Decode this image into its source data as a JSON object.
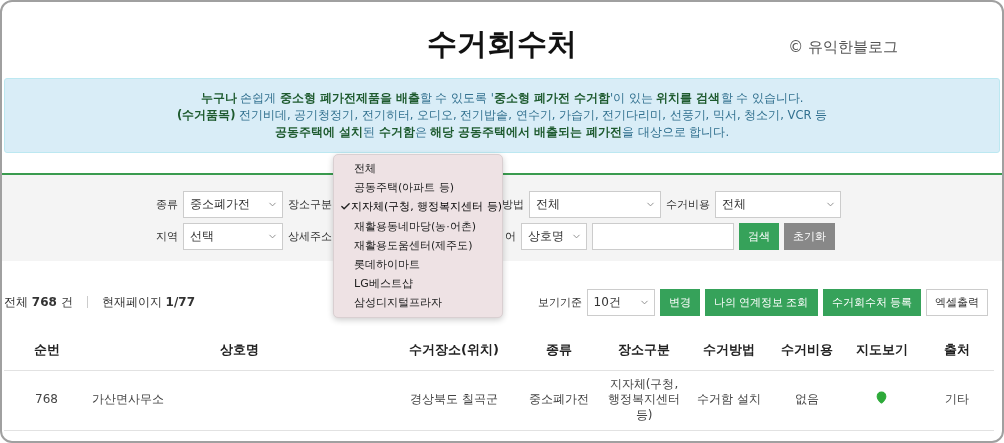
{
  "header": {
    "title": "수거회수처",
    "credit": "© 유익한블로그"
  },
  "notice": {
    "lines": [
      "**누구나** 손쉽게 **중소형 폐가전제품을 배출**할 수 있도록 '**중소형 폐가전 수거함**'이 있는 **위치를 검색**할 수 있습니다.",
      "**(수거품목)** 전기비데, 공기청정기, 전기히터, 오디오, 전기밥솥, 연수기, 가습기, 전기다리미, 선풍기, 믹서, 청소기, VCR 등",
      "**공동주택에 설치**된 **수거함**은 **해당 공동주택에서 배출되는 폐가전**을 대상으로 합니다."
    ]
  },
  "filters": [
    [
      {
        "kind": "select",
        "label": "종류",
        "value": "중소폐가전"
      },
      {
        "kind": "covered",
        "label": "장소구분"
      },
      {
        "kind": "select",
        "label": "방법",
        "value": "전체"
      },
      {
        "kind": "select",
        "label": "수거비용",
        "value": "전체"
      }
    ],
    [
      {
        "kind": "select",
        "label": "지역",
        "value": "선택"
      },
      {
        "kind": "covered",
        "label": "상세주소"
      },
      {
        "kind": "select",
        "label": "어",
        "value": "상호명"
      },
      {
        "kind": "input"
      },
      {
        "kind": "button",
        "label": "검색"
      },
      {
        "kind": "button",
        "label": "초기화"
      }
    ]
  ],
  "dropdown": {
    "items": [
      {
        "label": "전체",
        "selected": false
      },
      {
        "label": "공동주택(아파트 등)",
        "selected": false
      },
      {
        "label": "지자체(구청, 행정복지센터 등)",
        "selected": true
      },
      {
        "label": "재활용동네마당(농·어촌)",
        "selected": false
      },
      {
        "label": "재활용도움센터(제주도)",
        "selected": false
      },
      {
        "label": "롯데하이마트",
        "selected": false
      },
      {
        "label": "LG베스트샵",
        "selected": false
      },
      {
        "label": "삼성디지털프라자",
        "selected": false
      }
    ]
  },
  "summary": {
    "total": "전체 **768** 건",
    "page": "현재페이지 **1/77**",
    "view_label": "보기기준",
    "view_value": "10건",
    "buttons": [
      "변경",
      "나의 연계정보 조회",
      "수거회수처 등록",
      "엑셀출력"
    ]
  },
  "table": {
    "columns": [
      "순번",
      "상호명",
      "수거장소(위치)",
      "종류",
      "장소구분",
      "수거방법",
      "수거비용",
      "지도보기",
      "출처"
    ],
    "rows": [
      {
        "cells": [
          "768",
          "가산면사무소",
          "경상북도 칠곡군",
          "중소폐가전",
          "지자체(구청, 행정복지센터 등)",
          "수거함 설치",
          "없음",
          {
            "kind": "map-pin"
          },
          "기타"
        ]
      }
    ]
  }
}
